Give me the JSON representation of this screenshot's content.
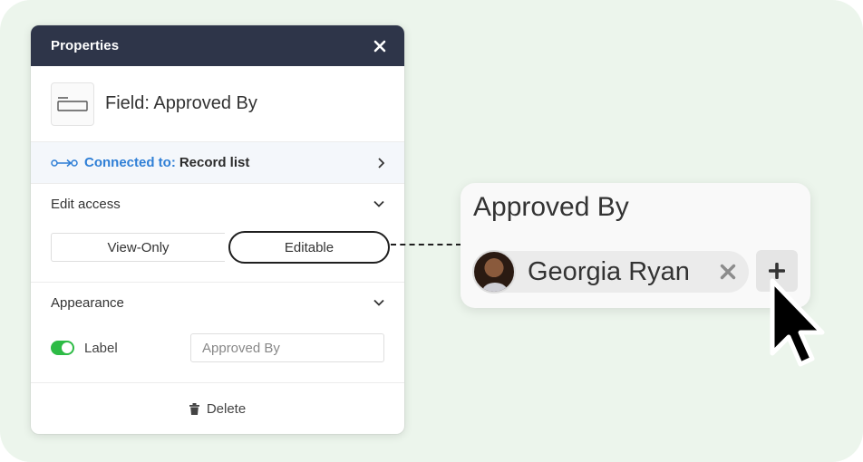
{
  "panel": {
    "title": "Properties",
    "field_title": "Field: Approved By",
    "connected": {
      "label": "Connected to:",
      "value": "Record list"
    },
    "edit_access": {
      "heading": "Edit access",
      "options": [
        "View-Only",
        "Editable"
      ],
      "selected": "Editable"
    },
    "appearance": {
      "heading": "Appearance",
      "label_toggle": {
        "label": "Label",
        "enabled": true
      },
      "label_input_value": "Approved By"
    },
    "delete_label": "Delete"
  },
  "preview": {
    "title": "Approved By",
    "user_chip": {
      "name": "Georgia Ryan"
    }
  },
  "icons": {
    "close": "close-icon",
    "field": "text-field-icon",
    "connect": "connection-icon",
    "chevron_right": "chevron-right-icon",
    "chevron_down": "chevron-down-icon",
    "trash": "trash-icon",
    "remove": "remove-icon",
    "add": "plus-icon",
    "cursor": "mouse-pointer-icon"
  },
  "colors": {
    "background": "#ecf5ec",
    "header": "#2e3549",
    "accent_blue": "#2f7fd6",
    "toggle_green": "#2dbb45"
  }
}
